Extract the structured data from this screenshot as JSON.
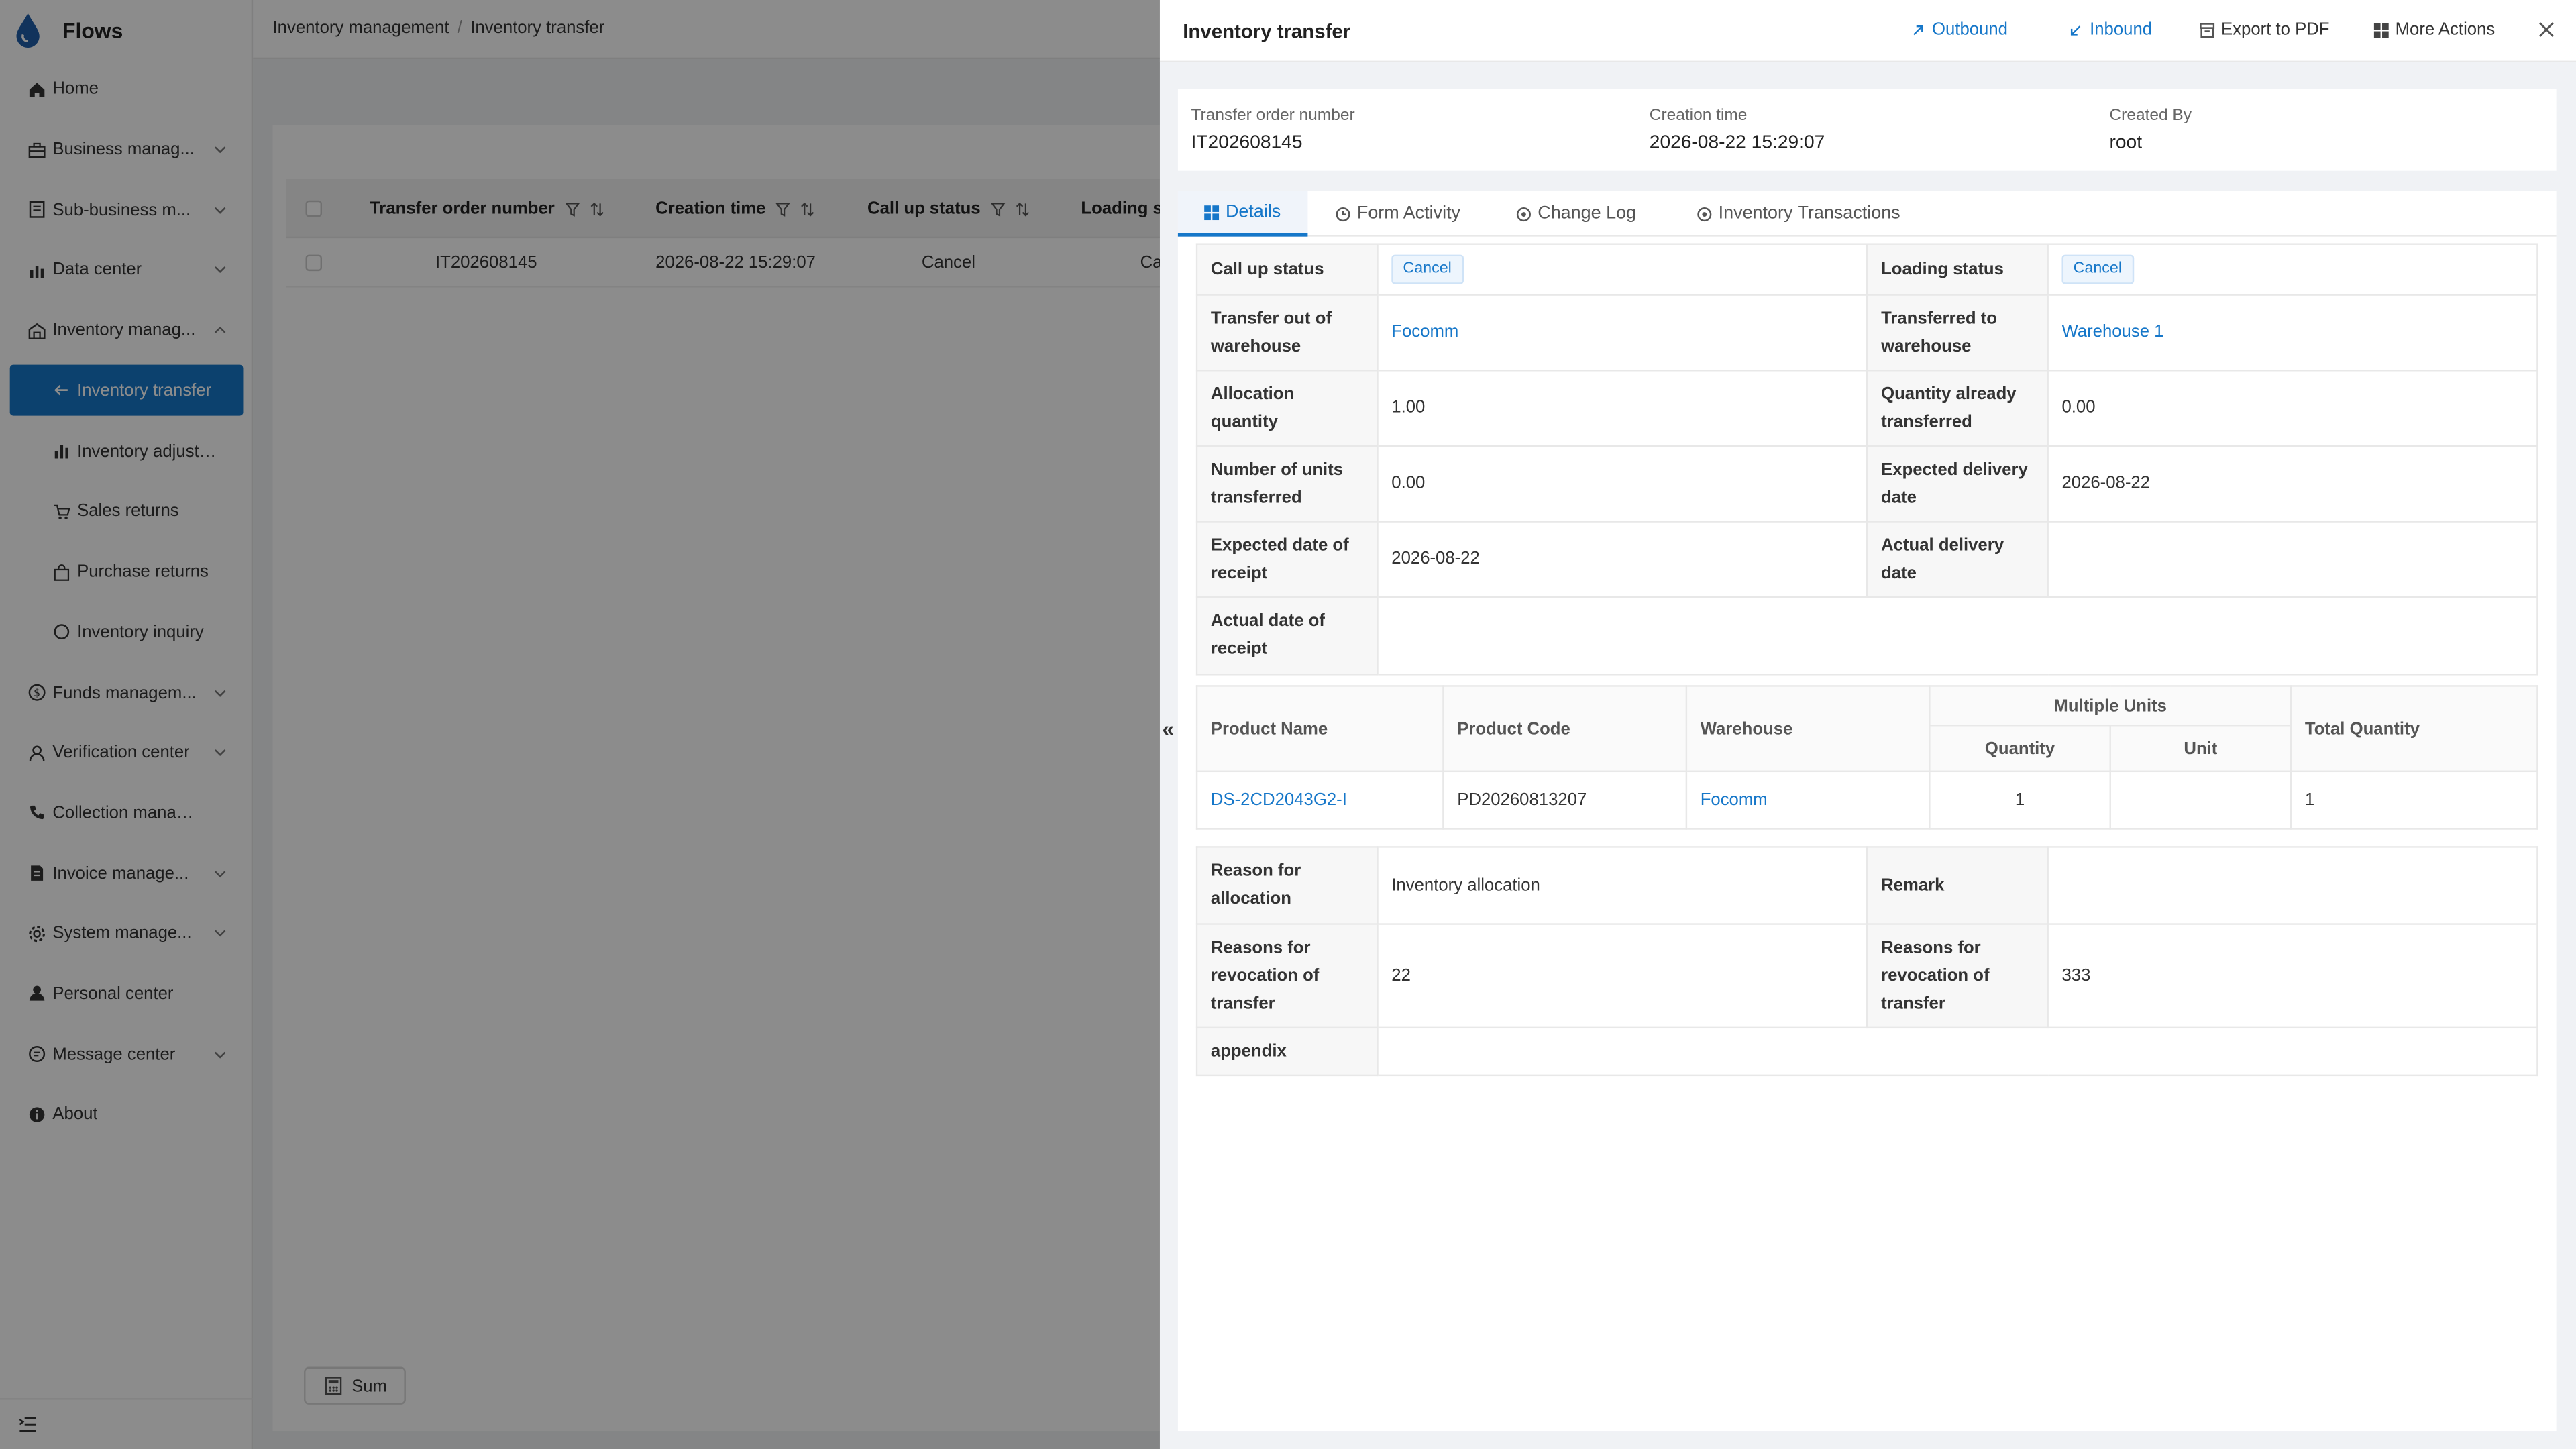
{
  "app": {
    "name": "Flows"
  },
  "sidebar": {
    "items": [
      {
        "label": "Home",
        "icon": "home-icon",
        "chevron": false
      },
      {
        "label": "Business manag...",
        "icon": "briefcase-icon",
        "chevron": true
      },
      {
        "label": "Sub-business m...",
        "icon": "document-icon",
        "chevron": true
      },
      {
        "label": "Data center",
        "icon": "bar-chart-icon",
        "chevron": true
      },
      {
        "label": "Inventory manag...",
        "icon": "warehouse-icon",
        "chevron": true,
        "expanded": true
      },
      {
        "label": "Inventory transfer",
        "icon": "arrow-left-icon",
        "sub": true,
        "active": true
      },
      {
        "label": "Inventory adjustm...",
        "icon": "bar-chart-icon",
        "sub": true
      },
      {
        "label": "Sales returns",
        "icon": "cart-icon",
        "sub": true
      },
      {
        "label": "Purchase returns",
        "icon": "bag-icon",
        "sub": true
      },
      {
        "label": "Inventory inquiry",
        "icon": "search-icon",
        "sub": true
      },
      {
        "label": "Funds managem...",
        "icon": "coin-icon",
        "chevron": true
      },
      {
        "label": "Verification center",
        "icon": "user-icon",
        "chevron": true
      },
      {
        "label": "Collection managem...",
        "icon": "phone-icon",
        "chevron": false
      },
      {
        "label": "Invoice manage...",
        "icon": "invoice-icon",
        "chevron": true
      },
      {
        "label": "System manage...",
        "icon": "gear-icon",
        "chevron": true
      },
      {
        "label": "Personal center",
        "icon": "person-icon",
        "chevron": false
      },
      {
        "label": "Message center",
        "icon": "message-icon",
        "chevron": true
      },
      {
        "label": "About",
        "icon": "info-icon",
        "chevron": false
      }
    ]
  },
  "breadcrumb": [
    "Inventory management",
    "Inventory transfer"
  ],
  "list": {
    "columns": [
      "Transfer order number",
      "Creation time",
      "Call up status",
      "Loading s"
    ],
    "row": {
      "order": "IT202608145",
      "time": "2026-08-22 15:29:07",
      "call_status": "Cancel",
      "loading": "Ca"
    },
    "sum_label": "Sum"
  },
  "drawer": {
    "title": "Inventory transfer",
    "actions": {
      "outbound": "Outbound",
      "inbound": "Inbound",
      "export": "Export to PDF",
      "more": "More Actions"
    },
    "info": [
      {
        "label": "Transfer order number",
        "value": "IT202608145"
      },
      {
        "label": "Creation time",
        "value": "2026-08-22 15:29:07"
      },
      {
        "label": "Created By",
        "value": "root"
      }
    ],
    "tabs": [
      "Details",
      "Form Activity",
      "Change Log",
      "Inventory Transactions"
    ],
    "details": {
      "call_up_status_label": "Call up status",
      "call_up_status": "Cancel",
      "loading_status_label": "Loading status",
      "loading_status": "Cancel",
      "transfer_out_label": "Transfer out of warehouse",
      "transfer_out": "Focomm",
      "transfer_to_label": "Transferred to warehouse",
      "transfer_to": "Warehouse 1",
      "allocation_qty_label": "Allocation quantity",
      "allocation_qty": "1.00",
      "qty_transferred_label": "Quantity already transferred",
      "qty_transferred": "0.00",
      "units_transferred_label": "Number of units transferred",
      "units_transferred": "0.00",
      "expected_delivery_label": "Expected delivery date",
      "expected_delivery": "2026-08-22",
      "expected_receipt_label": "Expected date of receipt",
      "expected_receipt": "2026-08-22",
      "actual_delivery_label": "Actual delivery date",
      "actual_delivery": "",
      "actual_receipt_label": "Actual date of receipt",
      "actual_receipt": ""
    },
    "products": {
      "headers": {
        "name": "Product Name",
        "code": "Product Code",
        "warehouse": "Warehouse",
        "multi": "Multiple Units",
        "qty": "Quantity",
        "unit": "Unit",
        "total": "Total Quantity"
      },
      "rows": [
        {
          "name": "DS-2CD2043G2-I",
          "code": "PD20260813207",
          "warehouse": "Focomm",
          "qty": "1",
          "unit": "",
          "total": "1"
        }
      ]
    },
    "extra": {
      "reason_label": "Reason for allocation",
      "reason": "Inventory allocation",
      "remark_label": "Remark",
      "remark": "",
      "revocation_label": "Reasons for revocation of transfer",
      "revocation": "22",
      "revocation2_label": "Reasons for revocation of transfer",
      "revocation2": "333",
      "appendix_label": "appendix",
      "appendix": ""
    }
  },
  "colors": {
    "accent": "#1677c9",
    "overlay": "rgba(0,0,0,0.45)"
  }
}
